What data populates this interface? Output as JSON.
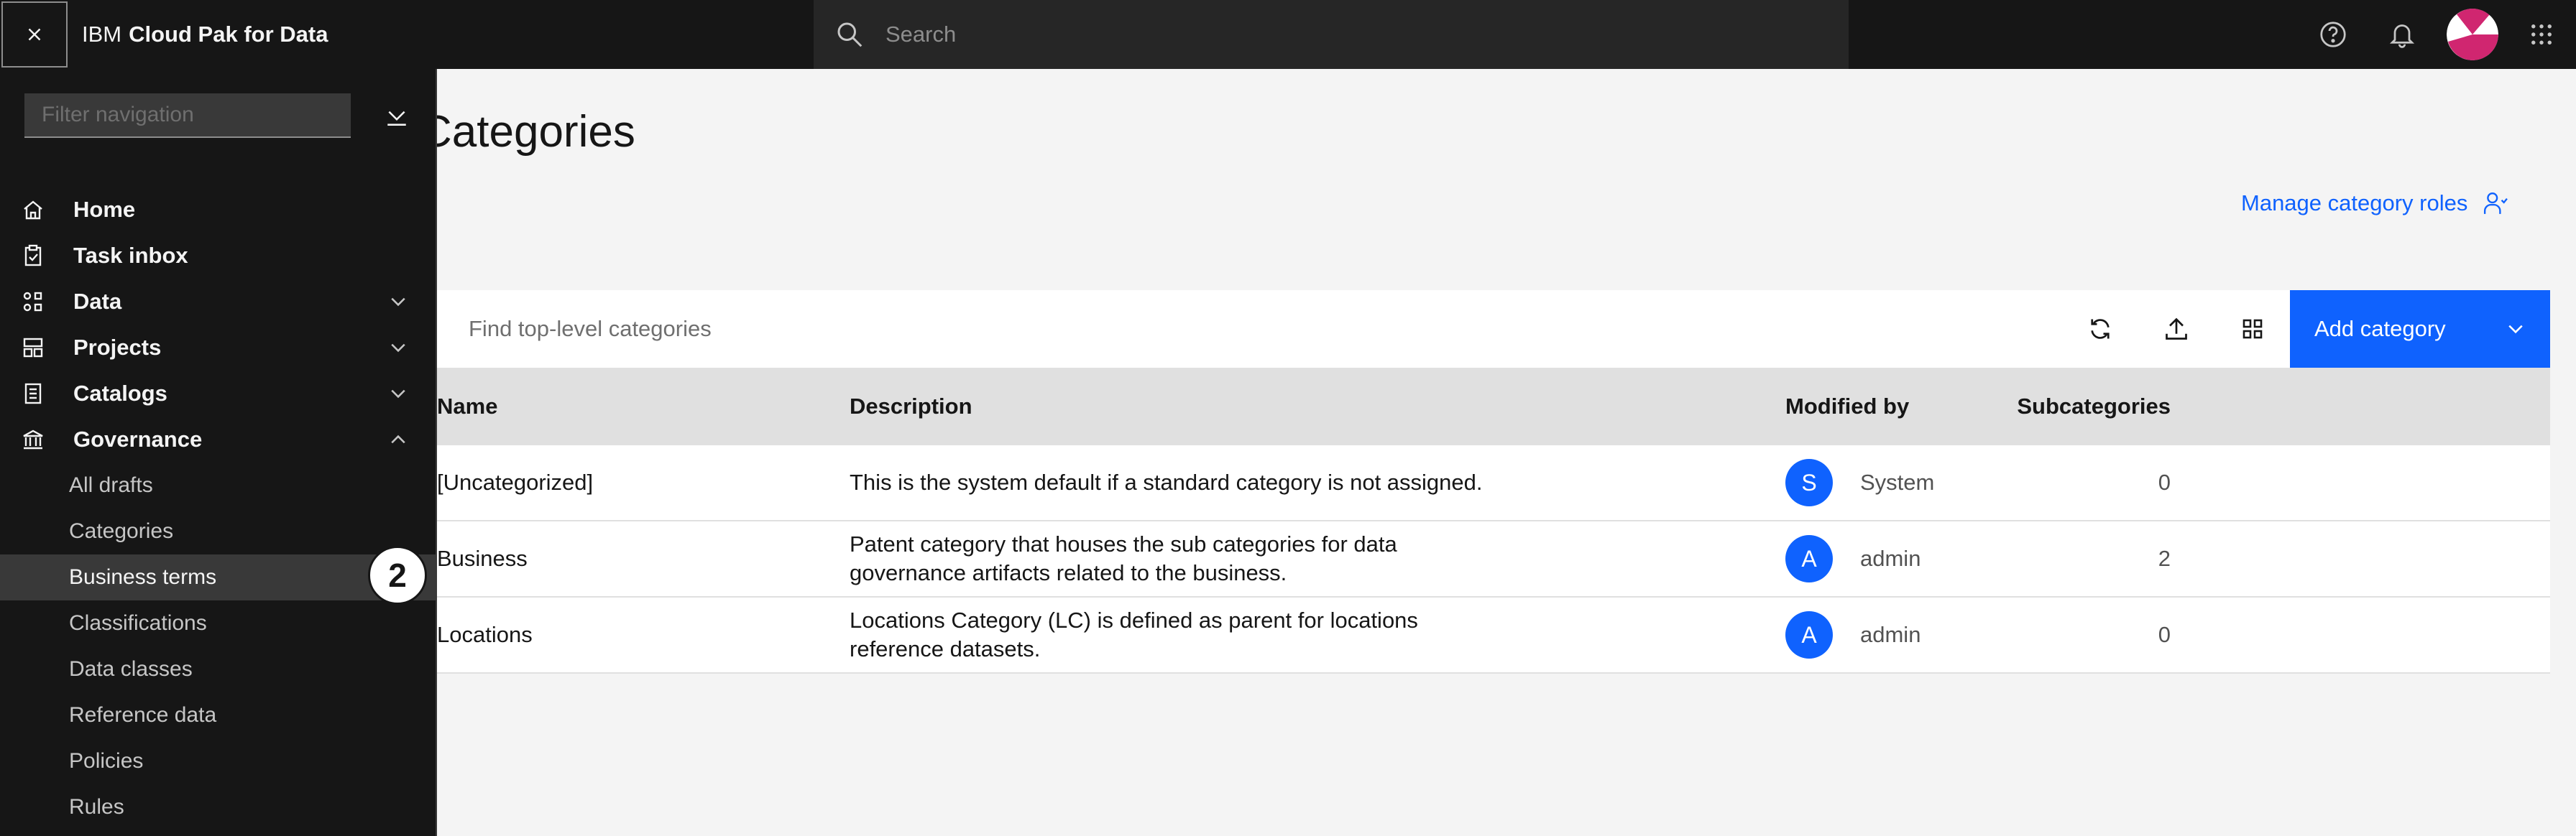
{
  "header": {
    "brand_prefix": "IBM",
    "brand_name": "Cloud Pak for Data",
    "search_placeholder": "Search"
  },
  "sidenav": {
    "filter_placeholder": "Filter navigation",
    "items": [
      {
        "label": "Home",
        "icon": "home-icon"
      },
      {
        "label": "Task inbox",
        "icon": "task-icon"
      },
      {
        "label": "Data",
        "icon": "data-icon",
        "expandable": true
      },
      {
        "label": "Projects",
        "icon": "projects-icon",
        "expandable": true
      },
      {
        "label": "Catalogs",
        "icon": "catalog-icon",
        "expandable": true
      },
      {
        "label": "Governance",
        "icon": "governance-icon",
        "expanded": true
      }
    ],
    "governance_items": [
      "All drafts",
      "Categories",
      "Business terms",
      "Classifications",
      "Data classes",
      "Reference data",
      "Policies",
      "Rules"
    ],
    "active_sub_item": "Business terms",
    "step_badge": "2"
  },
  "page": {
    "title": "Categories",
    "manage_roles_label": "Manage category roles"
  },
  "toolbar": {
    "find_placeholder": "Find top-level categories",
    "add_label": "Add category"
  },
  "table": {
    "headers": [
      "Name",
      "Description",
      "Subcategories",
      "Modified by"
    ],
    "rows": [
      {
        "name": "[Uncategorized]",
        "description": "This is the system default if a standard category is not assigned.",
        "subcategories": "0",
        "initial": "S",
        "modified_by": "System"
      },
      {
        "name": "Business",
        "description": "Patent category that houses the sub categories for data governance artifacts related to the business.",
        "subcategories": "2",
        "initial": "A",
        "modified_by": "admin"
      },
      {
        "name": "Locations",
        "description": "Locations Category (LC) is defined as parent for locations reference datasets.",
        "subcategories": "0",
        "initial": "A",
        "modified_by": "admin"
      }
    ]
  },
  "colors": {
    "accent": "#0f62fe",
    "header_bg": "#161616",
    "page_bg": "#f4f4f4"
  }
}
